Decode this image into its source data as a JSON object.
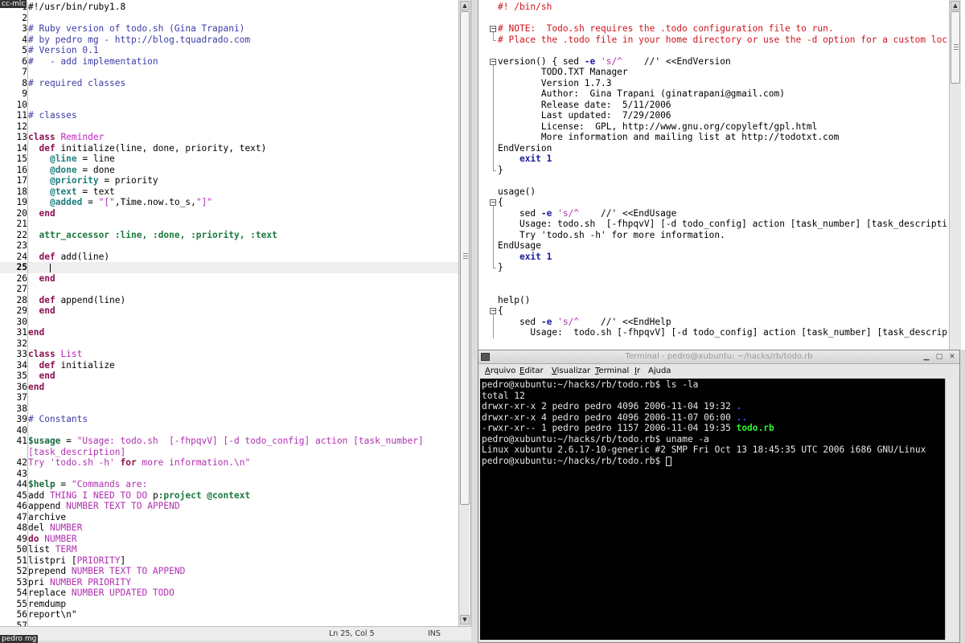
{
  "desktop": {
    "top_left_label": "cc-mlc",
    "bottom_left_label": "pedro mg"
  },
  "left_editor": {
    "current_line": 25,
    "lines": [
      {
        "n": "1",
        "tokens": [
          [
            "pl",
            "#!/usr/bin/ruby1.8"
          ]
        ]
      },
      {
        "n": "2",
        "tokens": []
      },
      {
        "n": "3",
        "tokens": [
          [
            "cm",
            "# Ruby version of todo.sh (Gina Trapani)"
          ]
        ]
      },
      {
        "n": "4",
        "tokens": [
          [
            "cm",
            "# by pedro mg - http://blog.tquadrado.com"
          ]
        ]
      },
      {
        "n": "5",
        "tokens": [
          [
            "cm",
            "# Version 0.1"
          ]
        ]
      },
      {
        "n": "6",
        "tokens": [
          [
            "cm",
            "#   - add implementation"
          ]
        ]
      },
      {
        "n": "7",
        "tokens": []
      },
      {
        "n": "8",
        "tokens": [
          [
            "cm",
            "# required classes"
          ]
        ]
      },
      {
        "n": "9",
        "tokens": []
      },
      {
        "n": "10",
        "tokens": []
      },
      {
        "n": "11",
        "tokens": [
          [
            "cm",
            "# classes"
          ]
        ]
      },
      {
        "n": "12",
        "tokens": []
      },
      {
        "n": "13",
        "tokens": [
          [
            "kw",
            "class"
          ],
          [
            "pl",
            " "
          ],
          [
            "cls",
            "Reminder"
          ]
        ]
      },
      {
        "n": "14",
        "tokens": [
          [
            "pl",
            "  "
          ],
          [
            "kw",
            "def"
          ],
          [
            "pl",
            " initialize(line, done, priority, text)"
          ]
        ]
      },
      {
        "n": "15",
        "tokens": [
          [
            "pl",
            "    "
          ],
          [
            "iv",
            "@line"
          ],
          [
            "pl",
            " = line"
          ]
        ]
      },
      {
        "n": "16",
        "tokens": [
          [
            "pl",
            "    "
          ],
          [
            "iv",
            "@done"
          ],
          [
            "pl",
            " = done"
          ]
        ]
      },
      {
        "n": "17",
        "tokens": [
          [
            "pl",
            "    "
          ],
          [
            "iv",
            "@priority"
          ],
          [
            "pl",
            " = priority"
          ]
        ]
      },
      {
        "n": "18",
        "tokens": [
          [
            "pl",
            "    "
          ],
          [
            "iv",
            "@text"
          ],
          [
            "pl",
            " = text"
          ]
        ]
      },
      {
        "n": "19",
        "tokens": [
          [
            "pl",
            "    "
          ],
          [
            "iv",
            "@added"
          ],
          [
            "pl",
            " = "
          ],
          [
            "str",
            "\"[\""
          ],
          [
            "pl",
            ","
          ],
          [
            "cst",
            "Time"
          ],
          [
            "pl",
            ".now.to_s,"
          ],
          [
            "str",
            "\"]\""
          ]
        ]
      },
      {
        "n": "20",
        "tokens": [
          [
            "pl",
            "  "
          ],
          [
            "kw",
            "end"
          ]
        ]
      },
      {
        "n": "21",
        "tokens": []
      },
      {
        "n": "22",
        "tokens": [
          [
            "pl",
            "  "
          ],
          [
            "sym",
            "attr_accessor :line, :done, :priority, :text"
          ]
        ]
      },
      {
        "n": "23",
        "tokens": []
      },
      {
        "n": "24",
        "tokens": [
          [
            "pl",
            "  "
          ],
          [
            "kw",
            "def"
          ],
          [
            "pl",
            " add(line)"
          ]
        ]
      },
      {
        "n": "25",
        "tokens": [
          [
            "pl",
            "    "
          ]
        ]
      },
      {
        "n": "26",
        "tokens": [
          [
            "pl",
            "  "
          ],
          [
            "kw",
            "end"
          ]
        ]
      },
      {
        "n": "27",
        "tokens": []
      },
      {
        "n": "28",
        "tokens": [
          [
            "pl",
            "  "
          ],
          [
            "kw",
            "def"
          ],
          [
            "pl",
            " append(line)"
          ]
        ]
      },
      {
        "n": "29",
        "tokens": [
          [
            "pl",
            "  "
          ],
          [
            "kw",
            "end"
          ]
        ]
      },
      {
        "n": "30",
        "tokens": []
      },
      {
        "n": "31",
        "tokens": [
          [
            "kw",
            "end"
          ]
        ]
      },
      {
        "n": "32",
        "tokens": []
      },
      {
        "n": "33",
        "tokens": [
          [
            "kw",
            "class"
          ],
          [
            "pl",
            " "
          ],
          [
            "cls",
            "List"
          ]
        ]
      },
      {
        "n": "34",
        "tokens": [
          [
            "pl",
            "  "
          ],
          [
            "kw",
            "def"
          ],
          [
            "pl",
            " initialize"
          ]
        ]
      },
      {
        "n": "35",
        "tokens": [
          [
            "pl",
            "  "
          ],
          [
            "kw",
            "end"
          ]
        ]
      },
      {
        "n": "36",
        "tokens": [
          [
            "kw",
            "end"
          ]
        ]
      },
      {
        "n": "37",
        "tokens": []
      },
      {
        "n": "38",
        "tokens": []
      },
      {
        "n": "39",
        "tokens": [
          [
            "cm",
            "# Constants"
          ]
        ]
      },
      {
        "n": "40",
        "tokens": []
      },
      {
        "n": "41",
        "tokens": [
          [
            "gv",
            "$usage"
          ],
          [
            "pl",
            " = "
          ],
          [
            "str",
            "\"Usage: todo.sh  [-fhpqvV] [-d todo_config] action [task_number]"
          ]
        ]
      },
      {
        "n": "",
        "tokens": [
          [
            "str",
            "[task_description]"
          ]
        ]
      },
      {
        "n": "42",
        "tokens": [
          [
            "str",
            "Try 'todo.sh -h' "
          ],
          [
            "kw",
            "for"
          ],
          [
            "str",
            " more information.\\n\""
          ]
        ]
      },
      {
        "n": "43",
        "tokens": []
      },
      {
        "n": "44",
        "tokens": [
          [
            "gv",
            "$help"
          ],
          [
            "pl",
            " = "
          ],
          [
            "str",
            "\"Commands are:"
          ]
        ]
      },
      {
        "n": "45",
        "tokens": [
          [
            "pl",
            "add "
          ],
          [
            "str",
            "THING I NEED TO DO "
          ],
          [
            "pl",
            "p"
          ],
          [
            "sym",
            ":project @context"
          ]
        ]
      },
      {
        "n": "46",
        "tokens": [
          [
            "pl",
            "append "
          ],
          [
            "str",
            "NUMBER TEXT TO APPEND"
          ]
        ]
      },
      {
        "n": "47",
        "tokens": [
          [
            "pl",
            "archive"
          ]
        ]
      },
      {
        "n": "48",
        "tokens": [
          [
            "pl",
            "del "
          ],
          [
            "str",
            "NUMBER"
          ]
        ]
      },
      {
        "n": "49",
        "tokens": [
          [
            "kw",
            "do"
          ],
          [
            "pl",
            " "
          ],
          [
            "str",
            "NUMBER"
          ]
        ]
      },
      {
        "n": "50",
        "tokens": [
          [
            "pl",
            "list "
          ],
          [
            "str",
            "TERM"
          ]
        ]
      },
      {
        "n": "51",
        "tokens": [
          [
            "pl",
            "listpri ["
          ],
          [
            "str",
            "PRIORITY"
          ],
          [
            "pl",
            "]"
          ]
        ]
      },
      {
        "n": "52",
        "tokens": [
          [
            "pl",
            "prepend "
          ],
          [
            "str",
            "NUMBER TEXT TO APPEND"
          ]
        ]
      },
      {
        "n": "53",
        "tokens": [
          [
            "pl",
            "pri "
          ],
          [
            "str",
            "NUMBER PRIORITY"
          ]
        ]
      },
      {
        "n": "54",
        "tokens": [
          [
            "pl",
            "replace "
          ],
          [
            "str",
            "NUMBER UPDATED TODO"
          ]
        ]
      },
      {
        "n": "55",
        "tokens": [
          [
            "pl",
            "remdump"
          ]
        ]
      },
      {
        "n": "56",
        "tokens": [
          [
            "pl",
            "report\\n\""
          ]
        ]
      },
      {
        "n": "57",
        "tokens": []
      }
    ],
    "status": {
      "position": "Ln 25, Col 5",
      "mode": "INS"
    }
  },
  "right_editor": {
    "lines": [
      {
        "fold": "",
        "tokens": [
          [
            "cm",
            "#! /bin/sh"
          ]
        ]
      },
      {
        "fold": "",
        "tokens": []
      },
      {
        "fold": "open",
        "tokens": [
          [
            "cm",
            "# NOTE:  Todo.sh requires the .todo configuration file to run."
          ]
        ]
      },
      {
        "fold": "end",
        "tokens": [
          [
            "cm",
            "# Place the .todo file in your home directory or use the -d option for a custom loc"
          ]
        ]
      },
      {
        "fold": "",
        "tokens": []
      },
      {
        "fold": "open",
        "tokens": [
          [
            "pl",
            "version() { sed "
          ],
          [
            "kw",
            "-e"
          ],
          [
            "pl",
            " "
          ],
          [
            "str",
            "'s/^"
          ],
          [
            "pl",
            "    //' <<EndVersion"
          ]
        ]
      },
      {
        "fold": "bar",
        "tokens": [
          [
            "pl",
            "        TODO.TXT Manager"
          ]
        ]
      },
      {
        "fold": "bar",
        "tokens": [
          [
            "pl",
            "        Version 1.7.3"
          ]
        ]
      },
      {
        "fold": "bar",
        "tokens": [
          [
            "pl",
            "        Author:  Gina Trapani (ginatrapani@gmail.com)"
          ]
        ]
      },
      {
        "fold": "bar",
        "tokens": [
          [
            "pl",
            "        Release date:  5/11/2006"
          ]
        ]
      },
      {
        "fold": "bar",
        "tokens": [
          [
            "pl",
            "        Last updated:  7/29/2006"
          ]
        ]
      },
      {
        "fold": "bar",
        "tokens": [
          [
            "pl",
            "        License:  GPL, http://www.gnu.org/copyleft/gpl.html"
          ]
        ]
      },
      {
        "fold": "bar",
        "tokens": [
          [
            "pl",
            "        More information and mailing list at http://todotxt.com"
          ]
        ]
      },
      {
        "fold": "bar",
        "tokens": [
          [
            "pl",
            "EndVersion"
          ]
        ]
      },
      {
        "fold": "bar",
        "tokens": [
          [
            "pl",
            "    "
          ],
          [
            "kw",
            "exit"
          ],
          [
            "pl",
            " "
          ],
          [
            "kw",
            "1"
          ]
        ]
      },
      {
        "fold": "end",
        "tokens": [
          [
            "pl",
            "}"
          ]
        ]
      },
      {
        "fold": "",
        "tokens": []
      },
      {
        "fold": "",
        "tokens": [
          [
            "pl",
            "usage()"
          ]
        ]
      },
      {
        "fold": "open",
        "tokens": [
          [
            "pl",
            "{"
          ]
        ]
      },
      {
        "fold": "bar",
        "tokens": [
          [
            "pl",
            "    sed "
          ],
          [
            "kw",
            "-e"
          ],
          [
            "pl",
            " "
          ],
          [
            "str",
            "'s/^"
          ],
          [
            "pl",
            "    //' <<EndUsage"
          ]
        ]
      },
      {
        "fold": "bar",
        "tokens": [
          [
            "pl",
            "    Usage: todo.sh  [-fhpqvV] [-d todo_config] action [task_number] [task_descripti"
          ]
        ]
      },
      {
        "fold": "bar",
        "tokens": [
          [
            "pl",
            "    Try 'todo.sh -h' for more information."
          ]
        ]
      },
      {
        "fold": "bar",
        "tokens": [
          [
            "pl",
            "EndUsage"
          ]
        ]
      },
      {
        "fold": "bar",
        "tokens": [
          [
            "pl",
            "    "
          ],
          [
            "kw",
            "exit"
          ],
          [
            "pl",
            " "
          ],
          [
            "kw",
            "1"
          ]
        ]
      },
      {
        "fold": "end",
        "tokens": [
          [
            "pl",
            "}"
          ]
        ]
      },
      {
        "fold": "",
        "tokens": []
      },
      {
        "fold": "",
        "tokens": []
      },
      {
        "fold": "",
        "tokens": [
          [
            "pl",
            "help()"
          ]
        ]
      },
      {
        "fold": "open",
        "tokens": [
          [
            "pl",
            "{"
          ]
        ]
      },
      {
        "fold": "bar",
        "tokens": [
          [
            "pl",
            "    sed "
          ],
          [
            "kw",
            "-e"
          ],
          [
            "pl",
            " "
          ],
          [
            "str",
            "'s/^"
          ],
          [
            "pl",
            "    //' <<EndHelp"
          ]
        ]
      },
      {
        "fold": "bar",
        "tokens": [
          [
            "pl",
            "      Usage:  todo.sh [-fhpqvV] [-d todo_config] action [task_number] [task_descrip"
          ]
        ]
      }
    ]
  },
  "terminal": {
    "title": "Terminal - pedro@xubuntu: ~/hacks/rb/todo.rb",
    "menu": [
      {
        "label": "Arquivo",
        "key": "A",
        "rest": "rquivo"
      },
      {
        "label": "Editar",
        "key": "E",
        "rest": "ditar"
      },
      {
        "label": "Visualizar",
        "key": "V",
        "rest": "isualizar"
      },
      {
        "label": "Terminal",
        "key": "T",
        "rest": "erminal"
      },
      {
        "label": "Ir",
        "key": "I",
        "rest": "r"
      },
      {
        "label": "Ajuda",
        "key": "j",
        "pre": "A",
        "rest": "uda"
      }
    ],
    "lines": [
      [
        [
          "n",
          "pedro@xubuntu:~/hacks/rb/todo.rb$ ls -la"
        ]
      ],
      [
        [
          "n",
          "total 12"
        ]
      ],
      [
        [
          "n",
          "drwxr-xr-x 2 pedro pedro 4096 2006-11-04 19:32 "
        ],
        [
          "blue",
          "."
        ]
      ],
      [
        [
          "n",
          "drwxr-xr-x 4 pedro pedro 4096 2006-11-07 06:00 "
        ],
        [
          "blue",
          ".."
        ]
      ],
      [
        [
          "n",
          "-rwxr-xr-- 1 pedro pedro 1157 2006-11-04 19:35 "
        ],
        [
          "green",
          "todo.rb"
        ]
      ],
      [
        [
          "n",
          "pedro@xubuntu:~/hacks/rb/todo.rb$ uname -a"
        ]
      ],
      [
        [
          "n",
          "Linux xubuntu 2.6.17-10-generic #2 SMP Fri Oct 13 18:45:35 UTC 2006 i686 GNU/Linux"
        ]
      ],
      [
        [
          "n",
          "pedro@xubuntu:~/hacks/rb/todo.rb$ "
        ],
        [
          "cursor",
          ""
        ]
      ]
    ]
  }
}
